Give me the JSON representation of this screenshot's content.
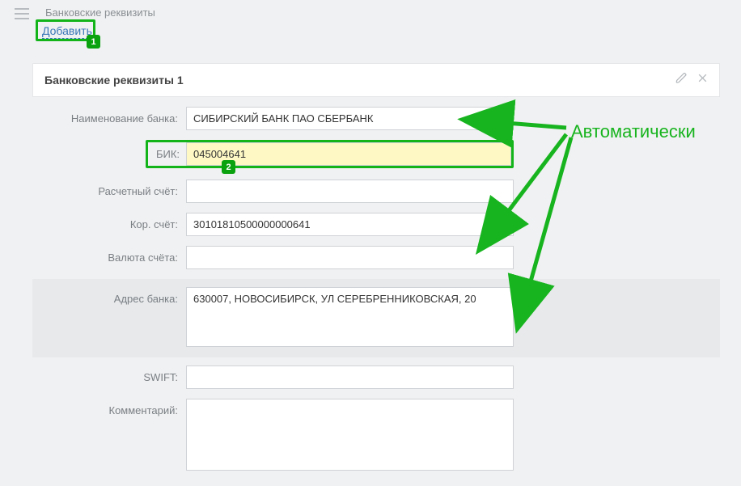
{
  "page": {
    "title": "Банковские реквизиты"
  },
  "actions": {
    "add": "Добавить"
  },
  "badges": {
    "one": "1",
    "two": "2"
  },
  "section": {
    "title": "Банковские реквизиты 1"
  },
  "labels": {
    "bank_name": "Наименование банка:",
    "bik": "БИК:",
    "account": "Расчетный счёт:",
    "corr_account": "Кор. счёт:",
    "currency": "Валюта счёта:",
    "bank_address": "Адрес банка:",
    "swift": "SWIFT:",
    "comment": "Комментарий:"
  },
  "values": {
    "bank_name": "СИБИРСКИЙ БАНК ПАО СБЕРБАНК",
    "bik": "045004641",
    "account": "",
    "corr_account": "30101810500000000641",
    "currency": "",
    "bank_address": "630007, НОВОСИБИРСК, УЛ СЕРЕБРЕННИКОВСКАЯ, 20",
    "swift": "",
    "comment": ""
  },
  "annotation": {
    "auto": "Автоматически"
  }
}
